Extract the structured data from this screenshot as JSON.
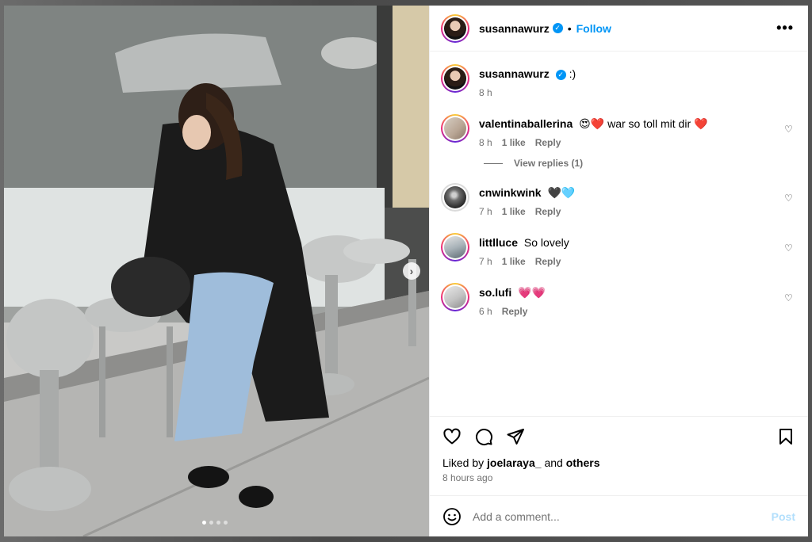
{
  "post": {
    "author": "susannawurz",
    "follow_label": "Follow",
    "separator": "•",
    "more_icon": "more-horizontal-icon",
    "carousel_next": "›"
  },
  "comments": [
    {
      "username": "susannawurz",
      "text": ":)",
      "time": "8 h",
      "verified": true,
      "caption": true
    },
    {
      "username": "valentinaballerina",
      "text": "😍❤️ war so toll mit dir ❤️",
      "time": "8 h",
      "likes": "1 like",
      "reply": "Reply",
      "view_replies": "View replies (1)"
    },
    {
      "username": "cnwinkwink",
      "text": "🖤🩵",
      "time": "7 h",
      "likes": "1 like",
      "reply": "Reply"
    },
    {
      "username": "littlluce",
      "text": "So lovely",
      "time": "7 h",
      "likes": "1 like",
      "reply": "Reply"
    },
    {
      "username": "so.lufi",
      "text": "💗💗",
      "time": "6 h",
      "reply": "Reply"
    }
  ],
  "likes": {
    "prefix": "Liked by",
    "user": "joelaraya_",
    "joiner": "and",
    "others": "others"
  },
  "posted_ago": "8 hours ago",
  "composer": {
    "placeholder": "Add a comment...",
    "post_label": "Post"
  },
  "colors": {
    "accent": "#0095f6",
    "post_disabled": "#b2dffc",
    "secondary_text": "#737373"
  }
}
